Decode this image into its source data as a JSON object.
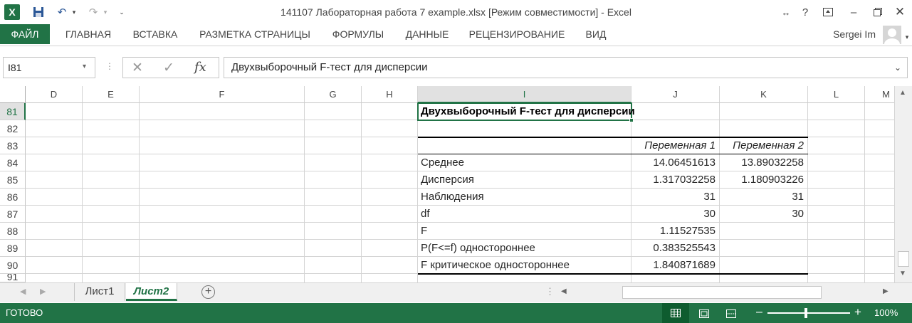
{
  "titlebar": {
    "title": "141107 Лабораторная работа 7 example.xlsx  [Режим совместимости] - Excel",
    "help": "?"
  },
  "ribbon": {
    "file_tab": "ФАЙЛ",
    "tabs": [
      "ГЛАВНАЯ",
      "ВСТАВКА",
      "РАЗМЕТКА СТРАНИЦЫ",
      "ФОРМУЛЫ",
      "ДАННЫЕ",
      "РЕЦЕНЗИРОВАНИЕ",
      "ВИД"
    ],
    "user": "Sergei Im"
  },
  "formula_bar": {
    "name_box": "I81",
    "fx": "fx",
    "formula": "Двухвыборочный F-тест для дисперсии"
  },
  "grid": {
    "columns": [
      "D",
      "E",
      "F",
      "G",
      "H",
      "I",
      "J",
      "K",
      "L",
      "M"
    ],
    "active_column": "I",
    "rows": [
      "81",
      "82",
      "83",
      "84",
      "85",
      "86",
      "87",
      "88",
      "89",
      "90",
      "91"
    ],
    "active_row": "81",
    "header_title": "Двухвыборочный F-тест для дисперсии",
    "var1_header": "Переменная 1",
    "var2_header": "Переменная 2",
    "table": [
      {
        "label": "Среднее",
        "v1": "14.06451613",
        "v2": "13.89032258"
      },
      {
        "label": "Дисперсия",
        "v1": "1.317032258",
        "v2": "1.180903226"
      },
      {
        "label": "Наблюдения",
        "v1": "31",
        "v2": "31"
      },
      {
        "label": "df",
        "v1": "30",
        "v2": "30"
      },
      {
        "label": "F",
        "v1": "1.11527535",
        "v2": ""
      },
      {
        "label": "P(F<=f) одностороннее",
        "v1": "0.383525543",
        "v2": ""
      },
      {
        "label": "F критическое одностороннее",
        "v1": "1.840871689",
        "v2": ""
      }
    ]
  },
  "sheets": {
    "tabs": [
      "Лист1",
      "Лист2"
    ],
    "active": "Лист2"
  },
  "status": {
    "ready": "ГОТОВО",
    "zoom": "100%"
  },
  "colors": {
    "accent": "#217346",
    "grid_line": "#d4d4d4"
  }
}
